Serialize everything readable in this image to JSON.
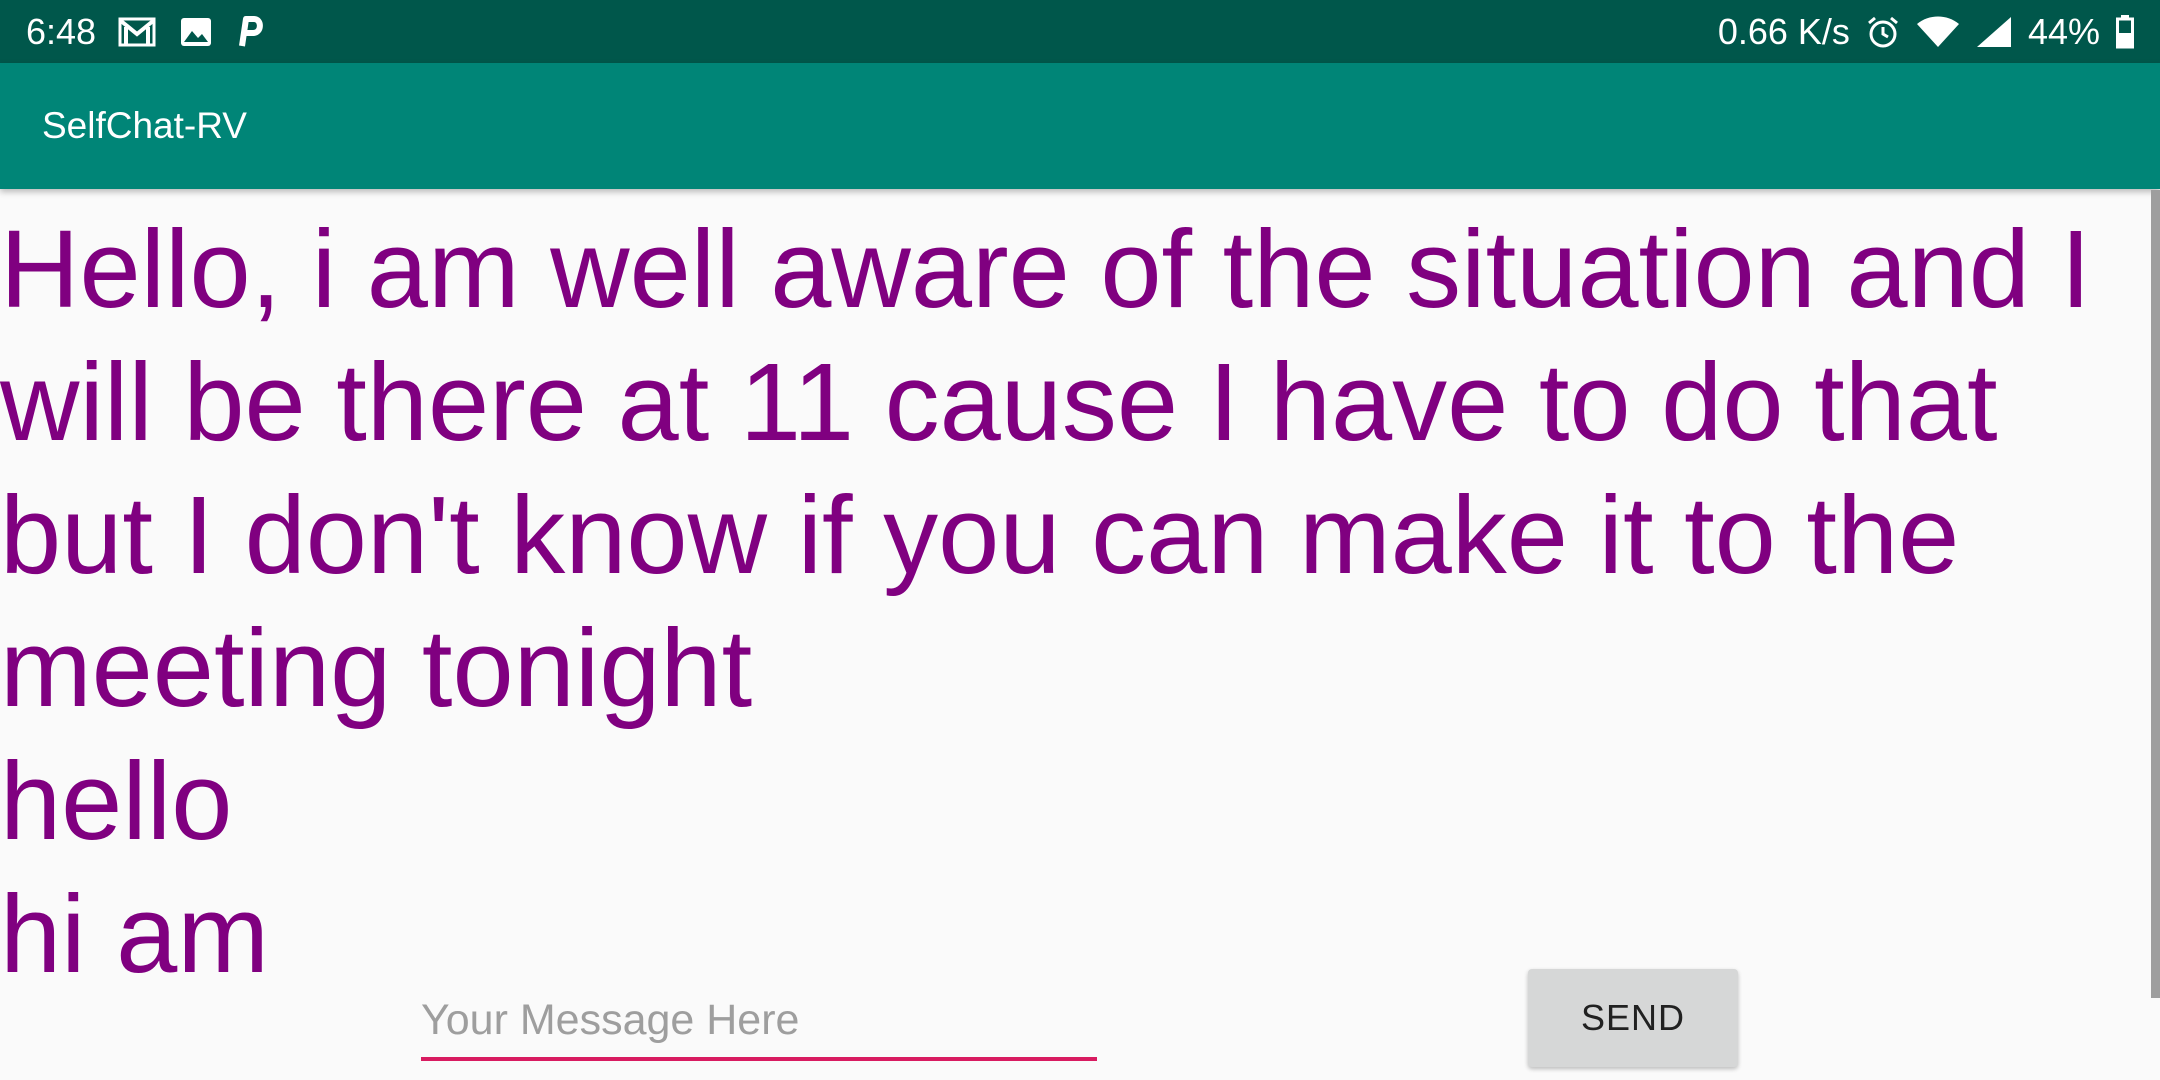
{
  "status_bar": {
    "time": "6:48",
    "left_icons": [
      "gmail-icon",
      "gallery-icon",
      "parking-icon"
    ],
    "net_speed": "0.66 K/s",
    "right_icons": [
      "alarm-icon",
      "wifi-icon",
      "signal-icon"
    ],
    "battery": "44%"
  },
  "app_bar": {
    "title": "SelfChat-RV"
  },
  "messages": [
    "Hello, i am well aware of the situation and I will be there at 11 cause I have to do that but I don't know if you can make it to the meeting tonight",
    "hello",
    "hi am"
  ],
  "input": {
    "placeholder": "Your Message Here",
    "value": ""
  },
  "send_button": {
    "label": "SEND"
  },
  "colors": {
    "status_bar": "#00574b",
    "app_bar": "#008577",
    "message_text": "#800080",
    "accent": "#d81b60",
    "button": "#d6d7d7"
  }
}
